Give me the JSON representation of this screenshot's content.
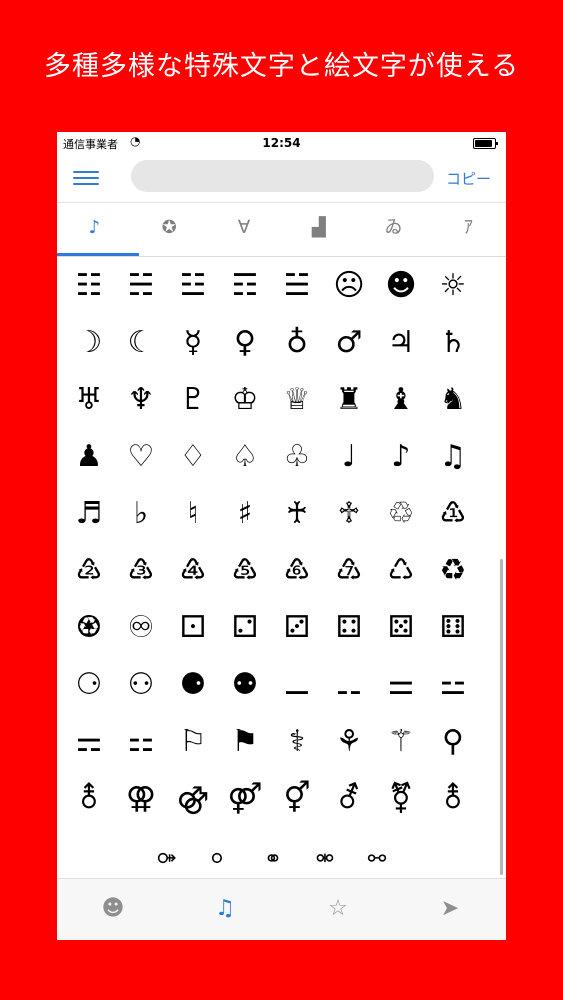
{
  "headline": "多種多様な特殊文字と絵文字が使える",
  "status": {
    "carrier": "通信事業者",
    "time": "12:54",
    "wifi": "wifi-icon"
  },
  "search": {
    "value": "",
    "placeholder": ""
  },
  "copy_label": "コピー",
  "tabs": [
    "♪",
    "✪",
    "∀",
    "▟",
    "ゐ",
    "ｱ"
  ],
  "symbols": [
    "☷",
    "☵",
    "☳",
    "☶",
    "☱",
    "☹",
    "☻",
    "☼",
    "☽",
    "☾",
    "☿",
    "♀",
    "♁",
    "♂",
    "♃",
    "♄",
    "♅",
    "♆",
    "♇",
    "♔",
    "♕",
    "♜",
    "♝",
    "♞",
    "♟",
    "♡",
    "♢",
    "♤",
    "♧",
    "♩",
    "♪",
    "♫",
    "♬",
    "♭",
    "♮",
    "♯",
    "♰",
    "♱",
    "♲",
    "♳",
    "♴",
    "♵",
    "♶",
    "♷",
    "♸",
    "♹",
    "♺",
    "♻",
    "♼",
    "♾",
    "⚀",
    "⚁",
    "⚂",
    "⚃",
    "⚄",
    "⚅",
    "⚆",
    "⚇",
    "⚈",
    "⚉",
    "⚊",
    "⚋",
    "⚌",
    "⚍",
    "⚎",
    "⚏",
    "⚐",
    "⚑",
    "⚕",
    "⚘",
    "⚚",
    "⚲",
    "⚨",
    "⚢",
    "⚣",
    "⚤",
    "⚥",
    "⚦",
    "⚧",
    "⚨",
    "⚩",
    "⚪",
    "⚭",
    "⚮",
    "⚯"
  ],
  "bottom_tabs": {
    "emoji": "☻",
    "music": "♫",
    "star": "☆",
    "send": "➤"
  }
}
